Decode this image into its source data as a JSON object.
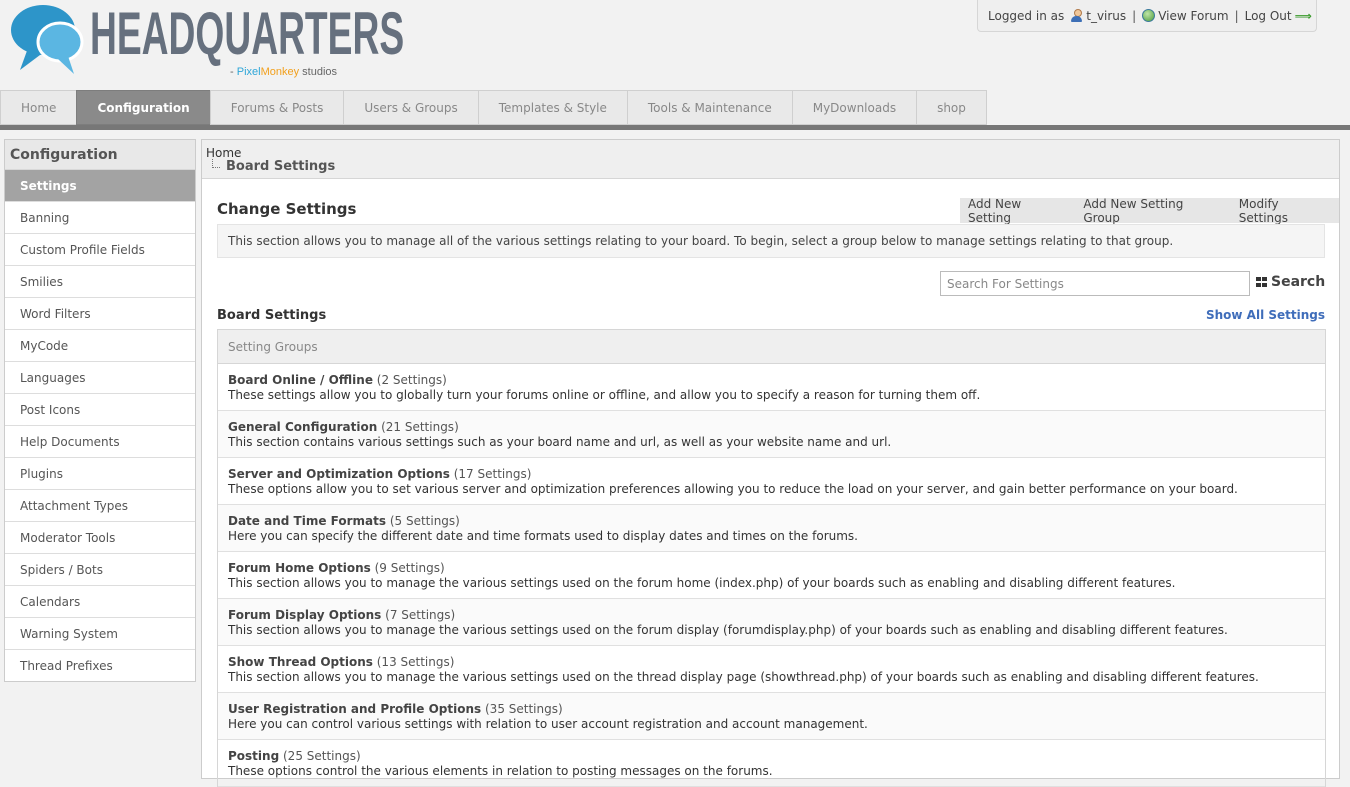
{
  "brand": {
    "logo_text": "HEADQUARTERS",
    "sub_prefix": "- ",
    "sub_pixel": "Pixel",
    "sub_monkey": "Monkey",
    "sub_studios": " studios",
    "colors": {
      "bubble_dark": "#2d95c9",
      "bubble_light": "#5bb6e2",
      "text": "#66707e"
    }
  },
  "user_bar": {
    "logged_in_label": "Logged in as",
    "username": "t_virus",
    "sep1": "|",
    "view_forum": "View Forum",
    "sep2": "|",
    "log_out": "Log Out",
    "arrow": "⟹"
  },
  "nav": {
    "tabs": [
      {
        "label": "Home"
      },
      {
        "label": "Configuration"
      },
      {
        "label": "Forums & Posts"
      },
      {
        "label": "Users & Groups"
      },
      {
        "label": "Templates & Style"
      },
      {
        "label": "Tools & Maintenance"
      },
      {
        "label": "MyDownloads"
      },
      {
        "label": "shop"
      }
    ]
  },
  "sidebar": {
    "title": "Configuration",
    "items": [
      {
        "label": "Settings"
      },
      {
        "label": "Banning"
      },
      {
        "label": "Custom Profile Fields"
      },
      {
        "label": "Smilies"
      },
      {
        "label": "Word Filters"
      },
      {
        "label": "MyCode"
      },
      {
        "label": "Languages"
      },
      {
        "label": "Post Icons"
      },
      {
        "label": "Help Documents"
      },
      {
        "label": "Plugins"
      },
      {
        "label": "Attachment Types"
      },
      {
        "label": "Moderator Tools"
      },
      {
        "label": "Spiders / Bots"
      },
      {
        "label": "Calendars"
      },
      {
        "label": "Warning System"
      },
      {
        "label": "Thread Prefixes"
      }
    ]
  },
  "breadcrumb": {
    "home": "Home",
    "current": "Board Settings"
  },
  "main": {
    "title": "Change Settings",
    "actions": [
      "Add New Setting",
      "Add New Setting Group",
      "Modify Settings"
    ],
    "intro": "This section allows you to manage all of the various settings relating to your board. To begin, select a group below to manage settings relating to that group.",
    "search": {
      "placeholder": "Search For Settings",
      "button": "Search"
    },
    "board_settings_title": "Board Settings",
    "show_all": "Show All Settings",
    "groups_header": "Setting Groups",
    "groups": [
      {
        "title": "Board Online / Offline",
        "count": "(2 Settings)",
        "desc": "These settings allow you to globally turn your forums online or offline, and allow you to specify a reason for turning them off."
      },
      {
        "title": "General Configuration",
        "count": "(21 Settings)",
        "desc": "This section contains various settings such as your board name and url, as well as your website name and url."
      },
      {
        "title": "Server and Optimization Options",
        "count": "(17 Settings)",
        "desc": "These options allow you to set various server and optimization preferences allowing you to reduce the load on your server, and gain better performance on your board."
      },
      {
        "title": "Date and Time Formats",
        "count": "(5 Settings)",
        "desc": "Here you can specify the different date and time formats used to display dates and times on the forums."
      },
      {
        "title": "Forum Home Options",
        "count": "(9 Settings)",
        "desc": "This section allows you to manage the various settings used on the forum home (index.php) of your boards such as enabling and disabling different features."
      },
      {
        "title": "Forum Display Options",
        "count": "(7 Settings)",
        "desc": "This section allows you to manage the various settings used on the forum display (forumdisplay.php) of your boards such as enabling and disabling different features."
      },
      {
        "title": "Show Thread Options",
        "count": "(13 Settings)",
        "desc": "This section allows you to manage the various settings used on the thread display page (showthread.php) of your boards such as enabling and disabling different features."
      },
      {
        "title": "User Registration and Profile Options",
        "count": "(35 Settings)",
        "desc": "Here you can control various settings with relation to user account registration and account management."
      },
      {
        "title": "Posting",
        "count": "(25 Settings)",
        "desc": "These options control the various elements in relation to posting messages on the forums."
      }
    ]
  }
}
